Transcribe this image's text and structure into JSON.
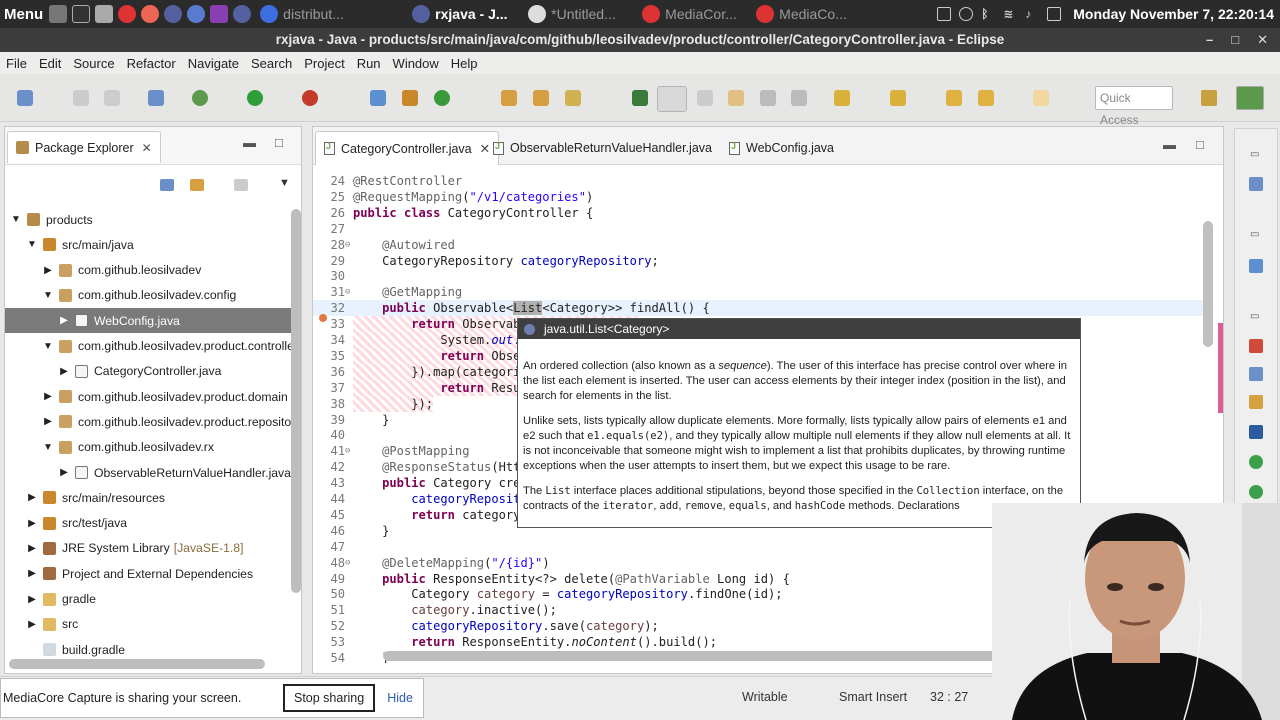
{
  "system_panel": {
    "menu_label": "Menu",
    "tasks": [
      {
        "label": "distribut...",
        "active": false
      },
      {
        "label": "rxjava - J...",
        "active": true
      },
      {
        "label": "*Untitled...",
        "active": false
      },
      {
        "label": "MediaCor...",
        "active": false
      },
      {
        "label": "MediaCo...",
        "active": false
      }
    ],
    "clock": "Monday November  7, 22:20:14"
  },
  "window": {
    "title": "rxjava - Java - products/src/main/java/com/github/leosilvadev/product/controller/CategoryController.java - Eclipse",
    "controls": [
      "–",
      "□",
      "✕"
    ]
  },
  "menubar": [
    "File",
    "Edit",
    "Source",
    "Refactor",
    "Navigate",
    "Search",
    "Project",
    "Run",
    "Window",
    "Help"
  ],
  "toolbar": {
    "quick_access_placeholder": "Quick Access"
  },
  "package_explorer": {
    "title": "Package Explorer",
    "tree": [
      {
        "label": "products",
        "level": 0,
        "twisty": "open",
        "icon": "project-icon"
      },
      {
        "label": "src/main/java",
        "level": 1,
        "twisty": "open",
        "icon": "source-folder-icon"
      },
      {
        "label": "com.github.leosilvadev",
        "level": 2,
        "twisty": "closed",
        "icon": "package-icon"
      },
      {
        "label": "com.github.leosilvadev.config",
        "level": 2,
        "twisty": "open",
        "icon": "package-icon"
      },
      {
        "label": "WebConfig.java",
        "level": 3,
        "twisty": "closed",
        "icon": "java-file-icon",
        "selected": true
      },
      {
        "label": "com.github.leosilvadev.product.controller",
        "level": 2,
        "twisty": "open",
        "icon": "package-icon"
      },
      {
        "label": "CategoryController.java",
        "level": 3,
        "twisty": "closed",
        "icon": "java-file-icon"
      },
      {
        "label": "com.github.leosilvadev.product.domain",
        "level": 2,
        "twisty": "closed",
        "icon": "package-icon"
      },
      {
        "label": "com.github.leosilvadev.product.repository",
        "level": 2,
        "twisty": "closed",
        "icon": "package-icon"
      },
      {
        "label": "com.github.leosilvadev.rx",
        "level": 2,
        "twisty": "open",
        "icon": "package-icon"
      },
      {
        "label": "ObservableReturnValueHandler.java",
        "level": 3,
        "twisty": "closed",
        "icon": "java-file-icon"
      },
      {
        "label": "src/main/resources",
        "level": 1,
        "twisty": "closed",
        "icon": "source-folder-icon"
      },
      {
        "label": "src/test/java",
        "level": 1,
        "twisty": "closed",
        "icon": "source-folder-icon"
      },
      {
        "label": "JRE System Library",
        "suffix": "[JavaSE-1.8]",
        "level": 1,
        "twisty": "closed",
        "icon": "library-icon"
      },
      {
        "label": "Project and External Dependencies",
        "level": 1,
        "twisty": "closed",
        "icon": "library-icon"
      },
      {
        "label": "gradle",
        "level": 1,
        "twisty": "closed",
        "icon": "folder-icon"
      },
      {
        "label": "src",
        "level": 1,
        "twisty": "closed",
        "icon": "folder-icon"
      },
      {
        "label": "build.gradle",
        "level": 1,
        "twisty": "none",
        "icon": "file-icon"
      }
    ]
  },
  "editor": {
    "tabs": [
      {
        "label": "CategoryController.java",
        "active": true
      },
      {
        "label": "ObservableReturnValueHandler.java",
        "active": false
      },
      {
        "label": "WebConfig.java",
        "active": false
      }
    ],
    "lines": [
      {
        "n": "24",
        "html": "<span class='ann'>@RestController</span>"
      },
      {
        "n": "25",
        "html": "<span class='ann'>@RequestMapping</span>(<span class='str'>\"/v1/categories\"</span>)"
      },
      {
        "n": "26",
        "html": "<span class='kw'>public class</span> CategoryController {"
      },
      {
        "n": "27",
        "html": ""
      },
      {
        "n": "28",
        "fold": true,
        "html": "    <span class='ann'>@Autowired</span>"
      },
      {
        "n": "29",
        "html": "    CategoryRepository <span class='fld'>categoryRepository</span>;"
      },
      {
        "n": "30",
        "html": ""
      },
      {
        "n": "31",
        "fold": true,
        "html": "    <span class='ann'>@GetMapping</span>"
      },
      {
        "n": "32",
        "hl": true,
        "html": "    <span class='kw'>public</span> Observable&lt;<span style='background:#b0b0b0'>List</span>&lt;Category&gt;&gt; findAll() {"
      },
      {
        "n": "33",
        "del": true,
        "html": "        <span class='kw'>return</span> Observable.<span class='it'>defer</span>(() -&gt; {"
      },
      {
        "n": "34",
        "del": true,
        "html": "            System.<span class='fld it'>out</span>.println(<span class='str'>\"...\"</span>);"
      },
      {
        "n": "35",
        "del": true,
        "html": "            <span class='kw'>return</span> Observable.<span class='it'>just</span>(<span class='fld'>categoryRepository</span>.findAll());"
      },
      {
        "n": "36",
        "del": true,
        "html": "        }).map(categories -&gt; {"
      },
      {
        "n": "37",
        "del": true,
        "html": "            <span class='kw'>return</span> Result.<span class='it'>of</span>(categories);"
      },
      {
        "n": "38",
        "del": true,
        "html": "        });"
      },
      {
        "n": "39",
        "html": "    }"
      },
      {
        "n": "40",
        "html": ""
      },
      {
        "n": "41",
        "fold": true,
        "html": "    <span class='ann'>@PostMapping</span>"
      },
      {
        "n": "42",
        "html": "    <span class='ann'>@ResponseStatus</span>(HttpStatus.<span class='fld it'>CREATED</span>)"
      },
      {
        "n": "43",
        "html": "    <span class='kw'>public</span> Category create(<span class='ann'>@RequestBody</span> Category category) {"
      },
      {
        "n": "44",
        "html": "        <span class='fld'>categoryRepository</span>.save(category);"
      },
      {
        "n": "45",
        "html": "        <span class='kw'>return</span> category;"
      },
      {
        "n": "46",
        "html": "    }"
      },
      {
        "n": "47",
        "html": ""
      },
      {
        "n": "48",
        "fold": true,
        "html": "    <span class='ann'>@DeleteMapping</span>(<span class='str'>\"/{id}\"</span>)"
      },
      {
        "n": "49",
        "html": "    <span class='kw'>public</span> ResponseEntity&lt;?&gt; delete(<span class='ann'>@PathVariable</span> Long id) {"
      },
      {
        "n": "50",
        "html": "        Category <span style='color:#6a3e3e'>category</span> = <span class='fld'>categoryRepository</span>.findOne(id);"
      },
      {
        "n": "51",
        "html": "        <span style='color:#6a3e3e'>category</span>.inactive();"
      },
      {
        "n": "52",
        "html": "        <span class='fld'>categoryRepository</span>.save(<span style='color:#6a3e3e'>category</span>);"
      },
      {
        "n": "53",
        "html": "        <span class='kw'>return</span> ResponseEntity.<span class='it'>noContent</span>().build();"
      },
      {
        "n": "54",
        "html": "    }"
      }
    ]
  },
  "hover_popup": {
    "title": "java.util.List<Category>",
    "p1": "An ordered collection (also known as a <i>sequence</i>). The user of this interface has precise control over where in the list each element is inserted. The user can access elements by their integer index (position in the list), and search for elements in the list.",
    "p2": "Unlike sets, lists typically allow duplicate elements. More formally, lists typically allow pairs of elements e1 and e2 such that <span class='mono'>e1.equals(e2)</span>, and they typically allow multiple null elements if they allow null elements at all. It is not inconceivable that someone might wish to implement a list that prohibits duplicates, by throwing runtime exceptions when the user attempts to insert them, but we expect this usage to be rare.",
    "p3": "The <span class='mono'>List</span> interface places additional stipulations, beyond those specified in the <span class='mono'>Collection</span> interface, on the contracts of the <span class='mono'>iterator</span>, <span class='mono'>add</span>, <span class='mono'>remove</span>, <span class='mono'>equals</span>, and <span class='mono'>hashCode</span> methods. Declarations"
  },
  "status": {
    "share_message": "MediaCore Capture is sharing your screen.",
    "stop_label": "Stop sharing",
    "hide_label": "Hide",
    "writable": "Writable",
    "insert_mode": "Smart Insert",
    "position": "32 : 27"
  },
  "colors": {
    "keyword": "#7f0055",
    "annotation": "#646464",
    "string": "#2a00ff",
    "field": "#0000c0",
    "selection": "#7a7a7a"
  }
}
